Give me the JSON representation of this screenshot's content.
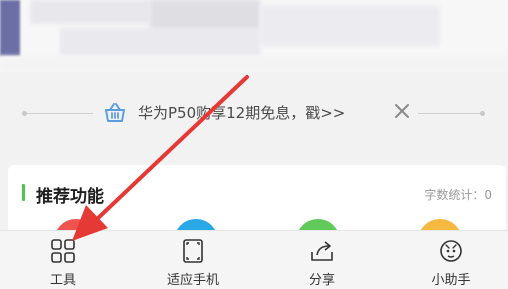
{
  "banner": {
    "text": "华为P50购享12期免息，戳>>",
    "icon": "shopping-basket-icon",
    "accent_color": "#5b9ee0"
  },
  "card": {
    "title": "推荐功能",
    "word_count": "字数统计：0",
    "accent_color": "#48c74f"
  },
  "bottom_nav": {
    "items": [
      {
        "label": "工具",
        "icon": "grid-tools-icon"
      },
      {
        "label": "适应手机",
        "icon": "fit-screen-icon"
      },
      {
        "label": "分享",
        "icon": "share-icon"
      },
      {
        "label": "小助手",
        "icon": "assistant-icon"
      }
    ]
  },
  "annotation": {
    "arrow_color": "#e53935"
  }
}
